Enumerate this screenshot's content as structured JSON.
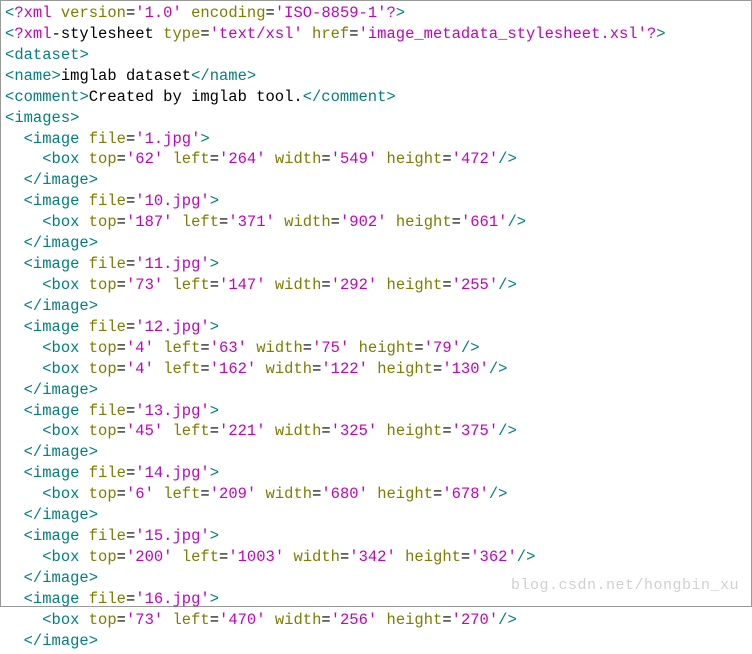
{
  "xml_decl": {
    "version": "1.0",
    "encoding": "ISO-8859-1"
  },
  "stylesheet": {
    "type": "text/xsl",
    "href": "image_metadata_stylesheet.xsl"
  },
  "dataset_name": "imglab dataset",
  "dataset_comment": "Created by imglab tool.",
  "images": [
    {
      "file": "1.jpg",
      "boxes": [
        {
          "top": "62",
          "left": "264",
          "width": "549",
          "height": "472"
        }
      ]
    },
    {
      "file": "10.jpg",
      "boxes": [
        {
          "top": "187",
          "left": "371",
          "width": "902",
          "height": "661"
        }
      ]
    },
    {
      "file": "11.jpg",
      "boxes": [
        {
          "top": "73",
          "left": "147",
          "width": "292",
          "height": "255"
        }
      ]
    },
    {
      "file": "12.jpg",
      "boxes": [
        {
          "top": "4",
          "left": "63",
          "width": "75",
          "height": "79"
        },
        {
          "top": "4",
          "left": "162",
          "width": "122",
          "height": "130"
        }
      ]
    },
    {
      "file": "13.jpg",
      "boxes": [
        {
          "top": "45",
          "left": "221",
          "width": "325",
          "height": "375"
        }
      ]
    },
    {
      "file": "14.jpg",
      "boxes": [
        {
          "top": "6",
          "left": "209",
          "width": "680",
          "height": "678"
        }
      ]
    },
    {
      "file": "15.jpg",
      "boxes": [
        {
          "top": "200",
          "left": "1003",
          "width": "342",
          "height": "362"
        }
      ]
    },
    {
      "file": "16.jpg",
      "boxes": [
        {
          "top": "73",
          "left": "470",
          "width": "256",
          "height": "270"
        }
      ]
    }
  ],
  "watermark": "blog.csdn.net/hongbin_xu"
}
